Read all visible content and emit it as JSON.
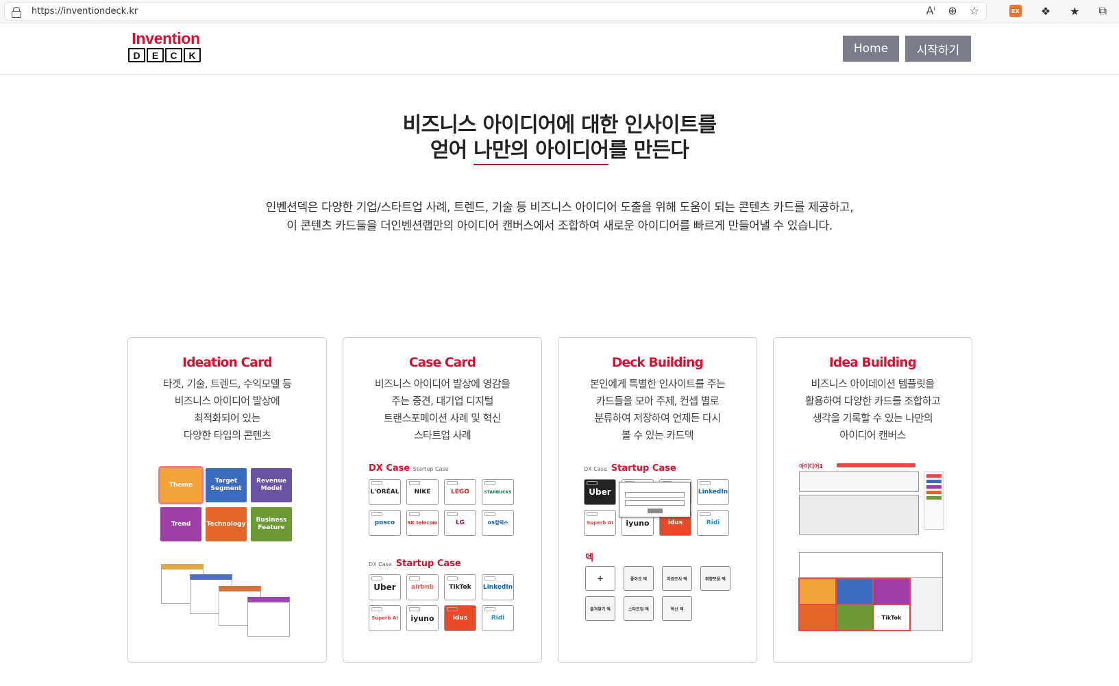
{
  "browser": {
    "url": "https://inventiondeck.kr",
    "ext_badge": "EX"
  },
  "header": {
    "logo_top": "Invention",
    "logo_letters": [
      "D",
      "E",
      "C",
      "K"
    ],
    "nav": [
      {
        "label": "Home"
      },
      {
        "label": "시작하기"
      }
    ]
  },
  "hero": {
    "title_line1": "비즈니스 아이디어에 대한 인사이트를",
    "title_line2_pre": "얻어 ",
    "title_line2_hl": "나만의 아이디어",
    "title_line2_post": "를 만든다",
    "desc_line1": "인벤션덱은 다양한 기업/스타트업 사례, 트렌드, 기술 등 비즈니스 아이디어 도출을 위해 도움이 되는 콘텐츠 카드를 제공하고,",
    "desc_line2": "이 콘텐츠 카드들을 더인벤션랩만의 아이디어 캔버스에서 조합하여 새로운 아이디어를 빠르게 만들어낼 수 있습니다."
  },
  "cards": [
    {
      "title": "Ideation Card",
      "desc": [
        "타겟, 기술, 트렌드, 수익모델 등",
        "비즈니스 아이디어 발상에",
        "최적화되어 있는",
        "다양한 타입의 콘텐츠"
      ],
      "tiles": [
        {
          "label": "Theme",
          "color": "#f2a436"
        },
        {
          "label": "Target Segment",
          "color": "#3b6bbf"
        },
        {
          "label": "Revenue Model",
          "color": "#6a53a5"
        },
        {
          "label": "Trend",
          "color": "#a03ea8"
        },
        {
          "label": "Technology",
          "color": "#e2652a"
        },
        {
          "label": "Business Feature",
          "color": "#6e9a36"
        }
      ]
    },
    {
      "title": "Case Card",
      "desc": [
        "비즈니스 아이디어 발상에 영감을",
        "주는 중견, 대기업 디지털",
        "트랜스포메이션 사례 및 혁신",
        "스타트업 사례"
      ],
      "dx_label": "DX Case",
      "dx_small": "Startup Case",
      "dx_logos": [
        "L'ORÉAL",
        "NIKE",
        "LEGO",
        "STARBUCKS",
        "posco",
        "SK telecom",
        "LG",
        "GS칼텍스"
      ],
      "startup_small": "DX Case",
      "startup_label": "Startup Case",
      "startup_logos": [
        "Uber",
        "airbnb",
        "TikTok",
        "LinkedIn",
        "Superb AI",
        "iyuno",
        "idus",
        "Ridi"
      ]
    },
    {
      "title": "Deck Building",
      "desc": [
        "본인에게 특별한 인사이트를 주는",
        "카드들을 모아 주제, 컨셉 별로",
        "분류하여 저장하여 언제든 다시",
        "볼 수 있는 카드덱"
      ],
      "small": "DX Case",
      "label": "Startup Case",
      "deck_label": "덱",
      "deck_buttons": [
        "+",
        "좋아요 덱",
        "자료조사 덱",
        "취향모음 덱",
        "즐겨찾기 덱",
        "스타트업 덱",
        "혁신 덱"
      ]
    },
    {
      "title": "Idea Building",
      "desc": [
        "비즈니스 아이데이션 템플릿을",
        "활용하여 다양한 카드를 조합하고",
        "생각을 기록할 수 있는 나만의",
        "아이디어 캔버스"
      ],
      "canvas_label": "아이디어1"
    }
  ]
}
